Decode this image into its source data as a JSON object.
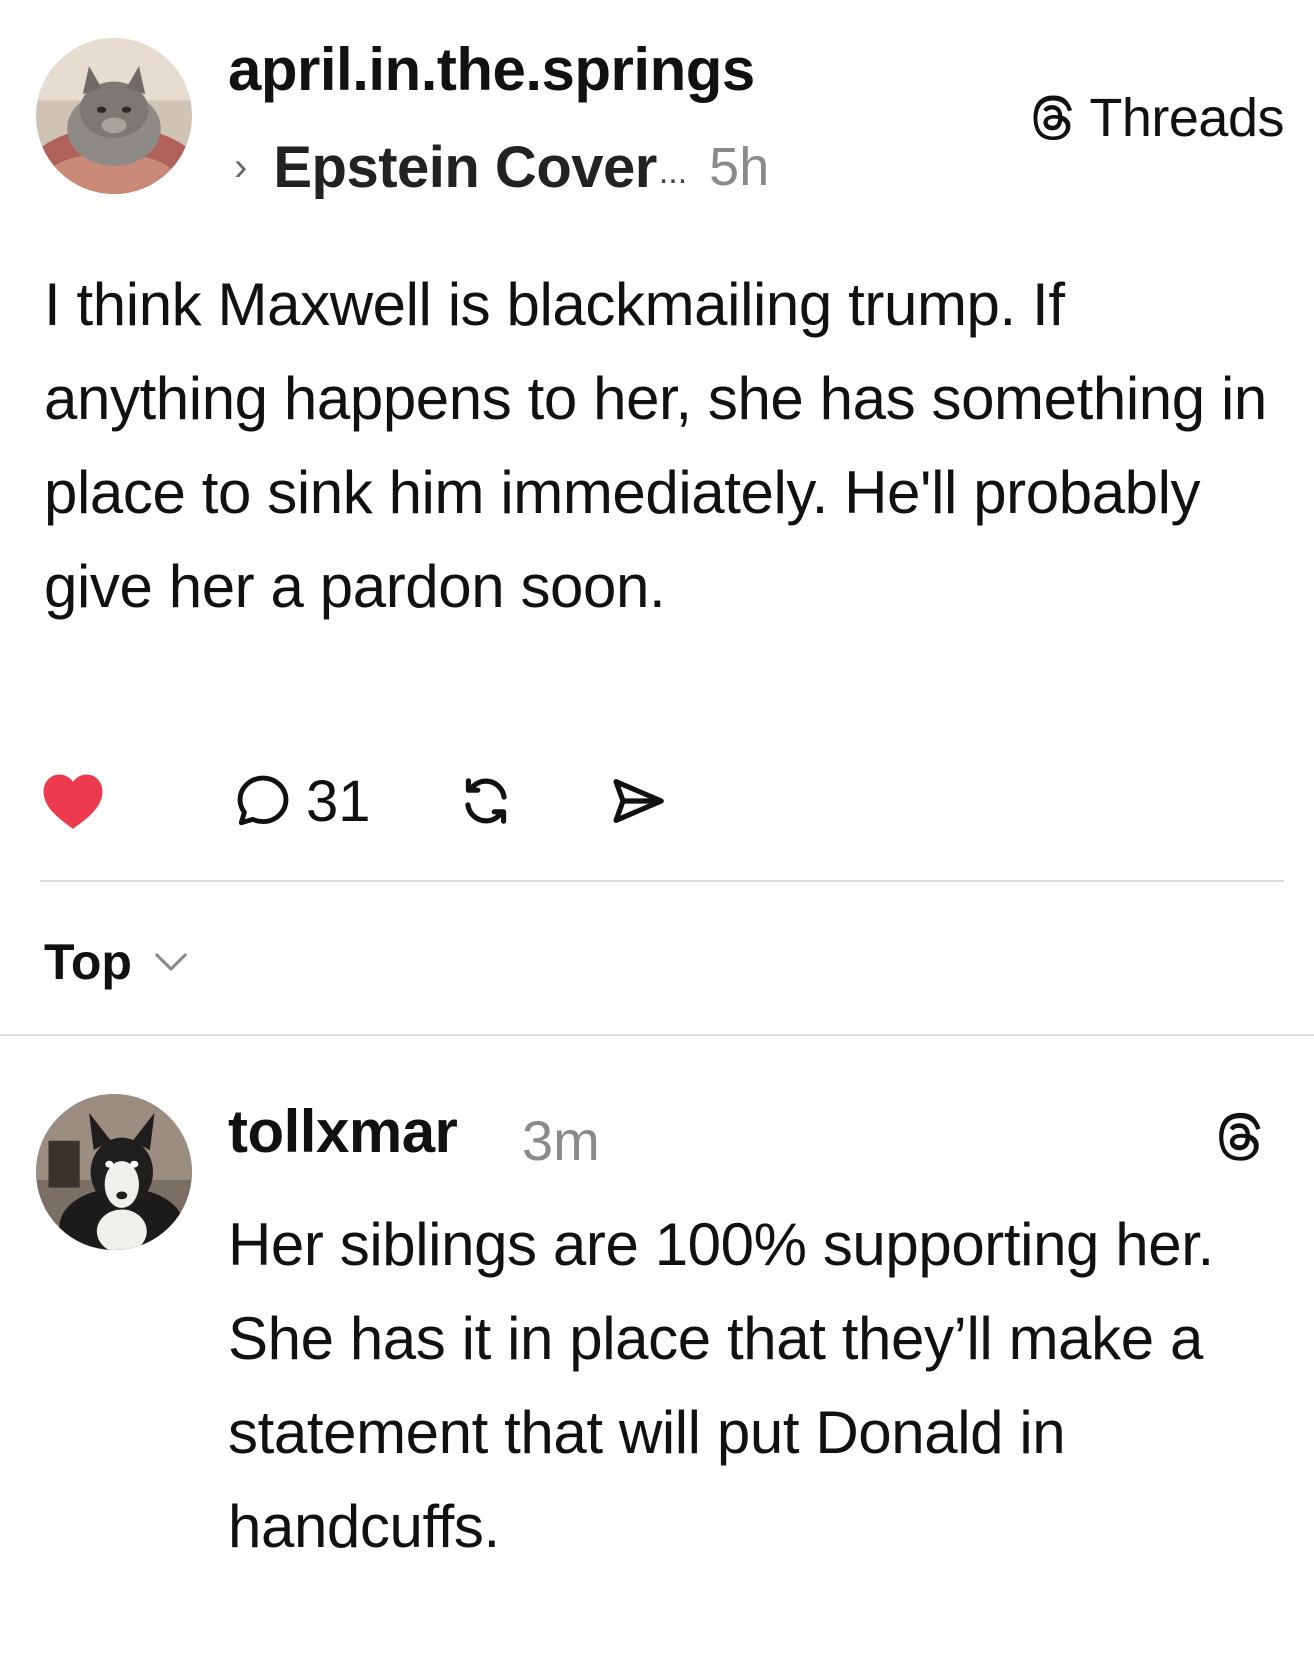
{
  "post": {
    "username": "april.in.the.springs",
    "topic_chevron": "›",
    "topic": "Epstein Cover",
    "topic_ellipsis": "...",
    "time": "5h",
    "text": "I think Maxwell is blackmailing trump. If anything happens to her, she has something in place to sink him immediately. He'll probably give her a pardon soon.",
    "liked": true,
    "reply_count": "31"
  },
  "badge": {
    "label": "Threads",
    "icon": "threads-logo-icon"
  },
  "sort": {
    "label": "Top",
    "icon": "chevron-down-icon"
  },
  "reply": {
    "username": "tollxmar",
    "time": "3m",
    "text": "Her siblings are 100% supporting her. She has it in place that they’ll make a statement that will put Donald in handcuffs.",
    "icon": "threads-logo-icon"
  },
  "colors": {
    "like": "#ed3a4d",
    "muted": "#8a8a8a",
    "divider": "#dcdcdc",
    "text": "#111111"
  }
}
